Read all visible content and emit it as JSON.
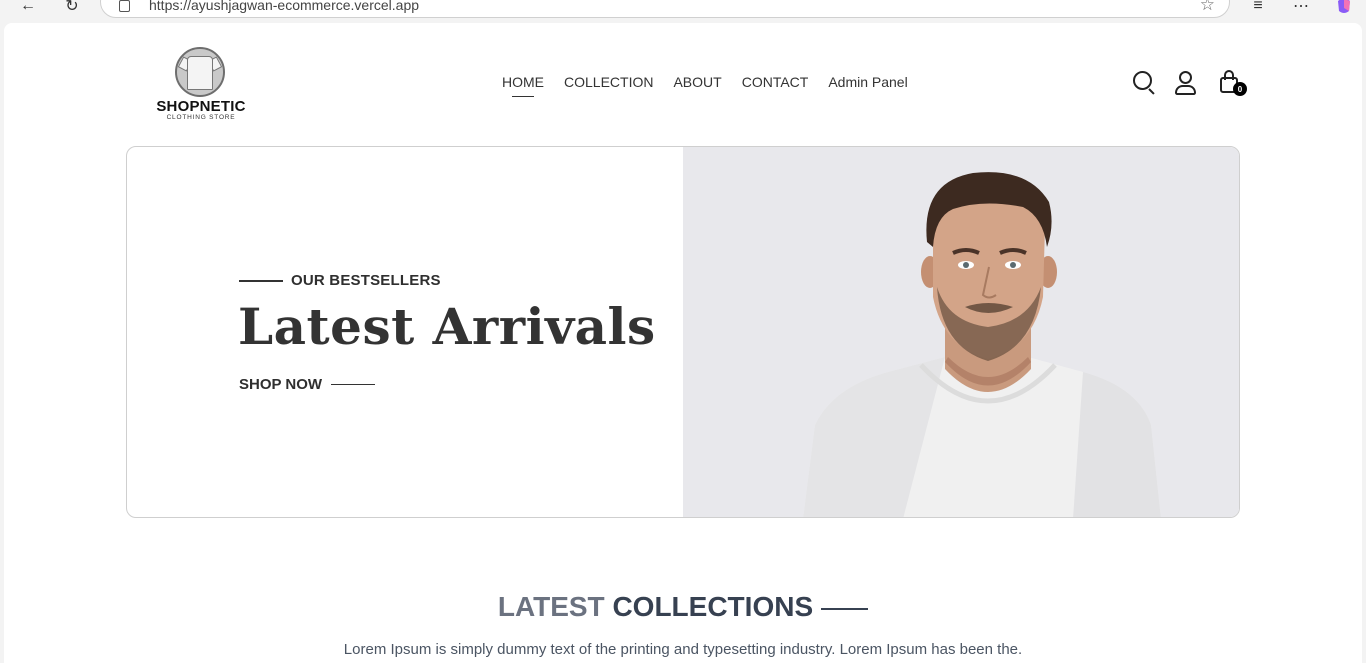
{
  "browser": {
    "url": "https://ayushjagwan-ecommerce.vercel.app"
  },
  "header": {
    "brand": "SHOPNETIC",
    "tagline": "CLOTHING STORE",
    "nav": [
      {
        "label": "HOME",
        "active": true
      },
      {
        "label": "COLLECTION",
        "active": false
      },
      {
        "label": "ABOUT",
        "active": false
      },
      {
        "label": "CONTACT",
        "active": false
      },
      {
        "label": "Admin Panel",
        "active": false
      }
    ],
    "cart_count": "0"
  },
  "hero": {
    "eyebrow": "OUR BESTSELLERS",
    "title": "Latest Arrivals",
    "cta": "SHOP NOW"
  },
  "collections": {
    "title_light": "LATEST",
    "title_bold": "COLLECTIONS",
    "subtitle": "Lorem Ipsum is simply dummy text of the printing and typesetting industry. Lorem Ipsum has been the."
  },
  "colors": {
    "hero_image_bg": "#e8e8ec",
    "text_dark": "#333333",
    "accent_gray": "#6b7280"
  }
}
